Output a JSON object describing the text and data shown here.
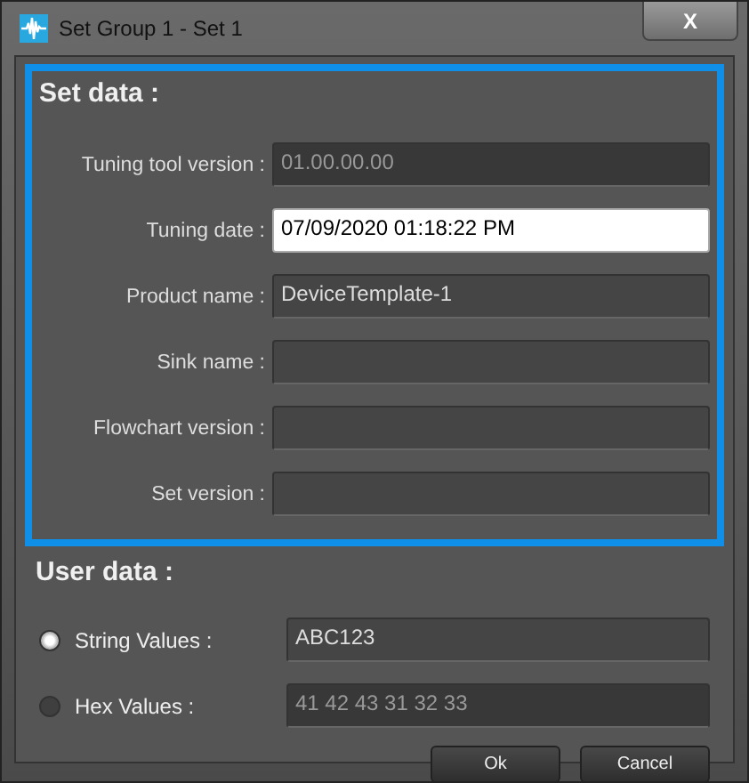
{
  "window": {
    "title": "Set Group 1 - Set 1",
    "close": "X"
  },
  "set_data": {
    "heading": "Set data :",
    "fields": [
      {
        "label": "Tuning tool version :",
        "value": "01.00.00.00",
        "disabled": true,
        "focused": false
      },
      {
        "label": "Tuning date :",
        "value": "07/09/2020 01:18:22 PM",
        "disabled": false,
        "focused": true
      },
      {
        "label": "Product name :",
        "value": "DeviceTemplate-1",
        "disabled": false,
        "focused": false
      },
      {
        "label": "Sink name :",
        "disabled": false,
        "focused": false
      },
      {
        "label": "Flowchart version :",
        "disabled": false,
        "focused": false
      },
      {
        "label": "Set version :",
        "disabled": false,
        "focused": false
      }
    ]
  },
  "user_data": {
    "heading": "User data :",
    "options": [
      {
        "label": "String Values :",
        "value": "ABC123",
        "selected": true
      },
      {
        "label": "Hex Values :",
        "value": "41 42 43 31 32 33",
        "selected": false
      }
    ]
  },
  "buttons": [
    "Ok",
    "Cancel"
  ]
}
